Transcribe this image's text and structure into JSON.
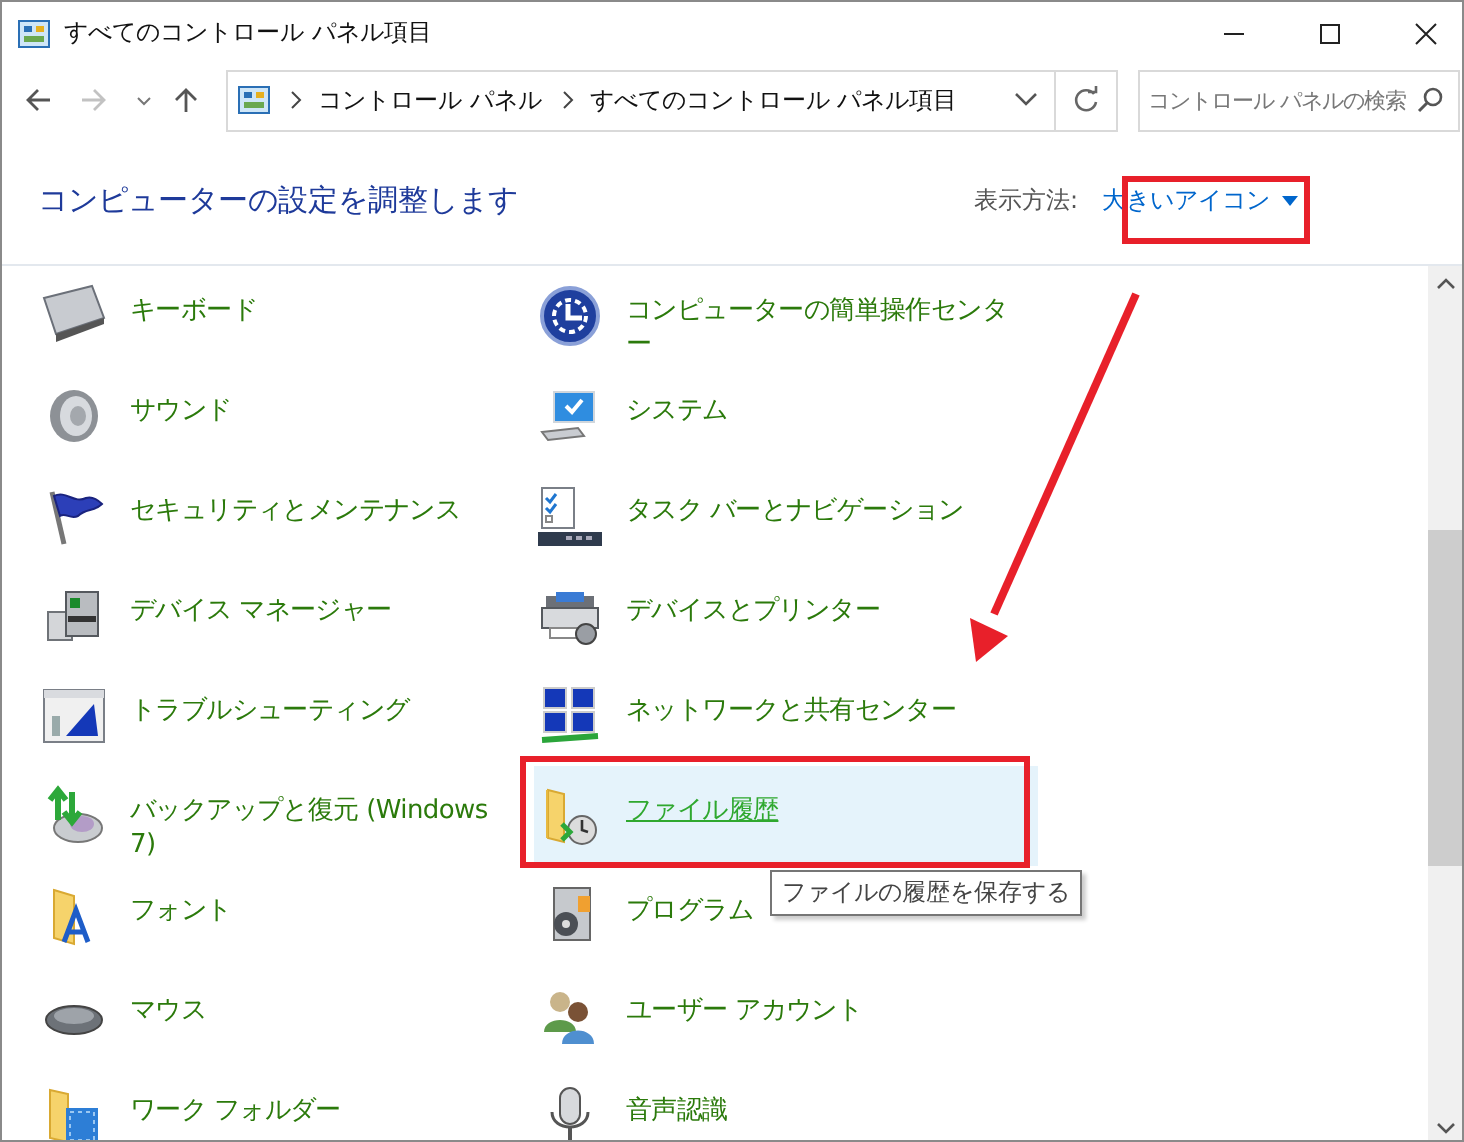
{
  "window": {
    "title": "すべてのコントロール パネル項目"
  },
  "address_bar": {
    "breadcrumbs": [
      "コントロール パネル",
      "すべてのコントロール パネル項目"
    ]
  },
  "search": {
    "placeholder": "コントロール パネルの検索"
  },
  "header": {
    "heading": "コンピューターの設定を調整します",
    "view_label": "表示方法:",
    "view_value": "大きいアイコン"
  },
  "items": [
    {
      "label": "キーボード",
      "selected": false
    },
    {
      "label": "コンピューターの簡単操作センター",
      "selected": false
    },
    {
      "label": "サウンド",
      "selected": false
    },
    {
      "label": "システム",
      "selected": false
    },
    {
      "label": "セキュリティとメンテナンス",
      "selected": false
    },
    {
      "label": "タスク バーとナビゲーション",
      "selected": false
    },
    {
      "label": "デバイス マネージャー",
      "selected": false
    },
    {
      "label": "デバイスとプリンター",
      "selected": false
    },
    {
      "label": "トラブルシューティング",
      "selected": false
    },
    {
      "label": "ネットワークと共有センター",
      "selected": false
    },
    {
      "label": "バックアップと復元 (Windows 7)",
      "selected": false
    },
    {
      "label": "ファイル履歴",
      "selected": true
    },
    {
      "label": "フォント",
      "selected": false
    },
    {
      "label": "プログラム",
      "selected": false
    },
    {
      "label": "マウス",
      "selected": false
    },
    {
      "label": "ユーザー アカウント",
      "selected": false
    },
    {
      "label": "ワーク フォルダー",
      "selected": false
    },
    {
      "label": "音声認識",
      "selected": false
    }
  ],
  "tooltip": {
    "text": "ファイルの履歴を保存する"
  }
}
